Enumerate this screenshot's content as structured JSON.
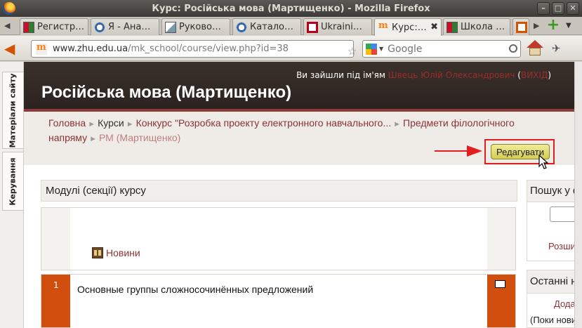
{
  "window": {
    "title": "Курс: Російська мова (Мартищенко) - Mozilla Firefox",
    "minimize": "–",
    "maximize": "□",
    "close": "✕"
  },
  "tabs": [
    {
      "label": "Регистр…",
      "icon": "colors-favicon"
    },
    {
      "label": "Я - Ана…",
      "icon": "circle-favicon"
    },
    {
      "label": "Руково…",
      "icon": "doc-favicon"
    },
    {
      "label": "Катало…",
      "icon": "circle-favicon"
    },
    {
      "label": "Ukraini…",
      "icon": "red-favicon"
    },
    {
      "label": "Курс:…",
      "icon": "moodle-favicon",
      "active": true
    },
    {
      "label": "Школа …",
      "icon": "colors-favicon"
    }
  ],
  "toolbar": {
    "url_prefix": "www.zhu.edu.ua",
    "url_path": "/mk_school/course/view.php?id=38",
    "search_placeholder": "Google"
  },
  "sidebar_tabs": [
    "Матеріали сайту",
    "Керування"
  ],
  "header": {
    "login_prefix": "Ви зайшли під ім'ям ",
    "user_name": "Швець Юлій Олександрович",
    "logout_open": " (",
    "logout_label": "ВИХІД",
    "logout_close": ")",
    "course_title": "Російська мова (Мартищенко)"
  },
  "breadcrumb": {
    "home": "Головна",
    "courses": "Курси",
    "contest": "Конкурс \"Розробка проекту електронного навчального...",
    "subjects": "Предмети філологічного напряму",
    "current": "РМ (Мартищенко)"
  },
  "edit_button": "Редагувати",
  "modules": {
    "header": "Модулі (секції) курсу",
    "news_label": "Новини",
    "section_1_number": "1",
    "section_1_title": "Основные группы сложносочинённых предложений"
  },
  "blocks": {
    "search_header": "Пошук у форумах",
    "search_advanced": "Розширений пошук",
    "latest_header": "Останні новини",
    "latest_add": "Додати нову тему",
    "latest_note": "(Поки нових новин немає)"
  },
  "colors": {
    "accent_orange": "#d24e0f",
    "header_dark": "#3b312b",
    "link": "#8a3434",
    "highlight_red": "#e41e1e",
    "button_yellow": "#e2dc6f"
  }
}
